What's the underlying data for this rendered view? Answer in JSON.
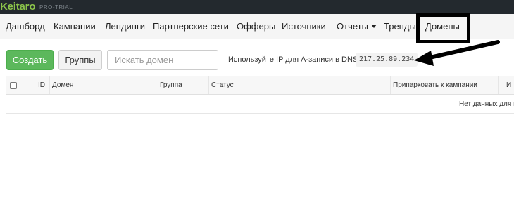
{
  "brand": {
    "logo": "Keitaro",
    "edition": "PRO-TRIAL",
    "accent_color": "#8bc34a"
  },
  "nav": {
    "items": [
      {
        "label": "Дашборд"
      },
      {
        "label": "Кампании"
      },
      {
        "label": "Лендинги"
      },
      {
        "label": "Партнерские сети"
      },
      {
        "label": "Офферы"
      },
      {
        "label": "Источники"
      },
      {
        "label": "Отчеты",
        "icon": "caret-down-icon"
      },
      {
        "label": "Тренды"
      },
      {
        "label": "Домены",
        "highlighted": true
      }
    ]
  },
  "toolbar": {
    "create_label": "Создать",
    "create_color": "#5cb85c",
    "groups_label": "Группы",
    "search_placeholder": "Искать домен",
    "search_value": "",
    "dns_hint": "Используйте IP для А-записи в DNS:",
    "dns_ip": "217.25.89.234"
  },
  "table": {
    "columns": [
      "ID",
      "Домен",
      "Группа",
      "Статус",
      "Припарковать к кампании",
      "И"
    ],
    "empty_message": "Нет данных для в"
  },
  "annotation": {
    "color": "#000000"
  }
}
